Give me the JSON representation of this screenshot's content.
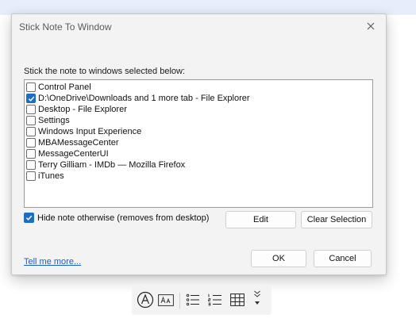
{
  "dialog": {
    "title": "Stick Note To Window",
    "instruction": "Stick the note to windows selected below:",
    "windows": [
      {
        "label": "Control Panel",
        "checked": false
      },
      {
        "label": "D:\\OneDrive\\Downloads and 1 more tab - File Explorer",
        "checked": true
      },
      {
        "label": "Desktop - File Explorer",
        "checked": false
      },
      {
        "label": "Settings",
        "checked": false
      },
      {
        "label": "Windows Input Experience",
        "checked": false
      },
      {
        "label": "MBAMessageCenter",
        "checked": false
      },
      {
        "label": "MessageCenterUI",
        "checked": false
      },
      {
        "label": "Terry Gilliam - IMDb — Mozilla Firefox",
        "checked": false
      },
      {
        "label": "iTunes",
        "checked": false
      }
    ],
    "hide_option": {
      "label": "Hide note otherwise (removes from desktop)",
      "checked": true
    },
    "edit_label": "Edit",
    "clear_label": "Clear Selection",
    "link_label": "Tell me more...",
    "ok_label": "OK",
    "cancel_label": "Cancel"
  },
  "toolbar": {
    "icons": [
      "handwriting-circle-a-icon",
      "font-size-icon",
      "bulleted-list-icon",
      "numbered-list-icon",
      "table-icon",
      "more-options-icon"
    ]
  },
  "colors": {
    "accent": "#1b6ec2",
    "link": "#1b5fc1"
  }
}
